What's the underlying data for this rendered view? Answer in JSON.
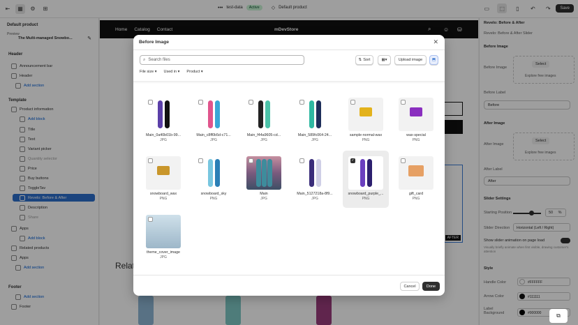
{
  "topbar": {
    "theme_name": "test-data",
    "theme_status": "Active",
    "template": "Default product",
    "save": "Save"
  },
  "left_panel": {
    "title": "Default product",
    "preview_label": "Preview",
    "preview_value": "The Multi-managed Snowbo...",
    "header_group": "Header",
    "header_items": [
      "Announcement bar",
      "Header"
    ],
    "add_section": "Add section",
    "template_group": "Template",
    "template_items": [
      "Product information",
      "Add block",
      "Title",
      "Text",
      "Variant picker",
      "Quantity selector",
      "Price",
      "Buy buttons",
      "ToggleTav",
      "Revelo: Before & After",
      "Description",
      "Share",
      "Apps",
      "Add block",
      "Related products",
      "Apps",
      "Add section"
    ],
    "footer_group": "Footer",
    "footer_items": [
      "Add section",
      "Footer"
    ]
  },
  "store": {
    "nav": [
      "Home",
      "Catalog",
      "Contact"
    ],
    "brand": "mDevStore",
    "related": "Relat",
    "badge": "AFTER"
  },
  "right_panel": {
    "title": "Revelo: Before & After",
    "subtitle": "Revelo: Before & After Slider",
    "before_image": "Before Image",
    "before_image_label": "Before Image",
    "select": "Select",
    "explore": "Explore free images",
    "before_label": "Before Label",
    "before_value": "Before",
    "after_image": "After Image",
    "after_image_label": "After Image",
    "select2": "Select",
    "explore2": "Explore free images",
    "after_label": "After Label",
    "after_value": "After",
    "slider_settings": "Slider Settings",
    "starting_position": "Starting Position",
    "starting_value": "50",
    "starting_unit": "%",
    "slider_direction": "Slider Direction",
    "direction_value": "Horizontal (Left / Right)",
    "show_anim": "Show slider animation on page load",
    "show_anim_desc": "Visually briefly animate when first visible, drawing customer's attention",
    "style": "Style",
    "handle_color": "Handle Color",
    "handle_value": "#FFFFFF",
    "arrow_color": "Arrow Color",
    "arrow_value": "#111111",
    "label_bg": "Label Background",
    "label_bg_value": "#000000"
  },
  "modal": {
    "title": "Before Image",
    "search_placeholder": "Search files",
    "sort": "Sort",
    "upload": "Upload image",
    "filters": [
      "File size",
      "Used in",
      "Product"
    ],
    "files": [
      {
        "name": "Main_0a40b01b-99...",
        "type": "JPG",
        "color": "#5b3fa8",
        "color2": "#111111"
      },
      {
        "name": "Main_c8ff0b5d-c71...",
        "type": "JPG",
        "color": "#e0558c",
        "color2": "#3aa7d6"
      },
      {
        "name": "Main_f44a9605-cd...",
        "type": "JPG",
        "color": "#222222",
        "color2": "#4cc2a8"
      },
      {
        "name": "Main_589fc064-24...",
        "type": "JPG",
        "color": "#2fb8a2",
        "color2": "#1d2e5a"
      },
      {
        "name": "sample-normal-wax",
        "type": "PNG",
        "color": "#e3b21c",
        "color2": ""
      },
      {
        "name": "wax-special",
        "type": "PNG",
        "color": "#8a2fbf",
        "color2": ""
      },
      {
        "name": "snowboard_wax",
        "type": "PNG",
        "color": "#c9962b",
        "color2": ""
      },
      {
        "name": "snowboard_sky",
        "type": "PNG",
        "color": "#78c6df",
        "color2": "#2b7fb6"
      },
      {
        "name": "Main",
        "type": "JPG",
        "color": "#7a5a7e",
        "color2": "#3e8c9c"
      },
      {
        "name": "Main_5127218a-8f9...",
        "type": "JPG",
        "color": "#3a2d7a",
        "color2": "#cfcfe6"
      },
      {
        "name": "snowboard_purple_...",
        "type": "PNG",
        "color": "#6a3fbf",
        "color2": "#2c1f6e"
      },
      {
        "name": "gift_card",
        "type": "PNG",
        "color": "#e6a064",
        "color2": ""
      },
      {
        "name": "theme_cover_image",
        "type": "JPG",
        "color": "#9db7c9",
        "color2": ""
      }
    ],
    "selected_index": 10,
    "cancel": "Cancel",
    "done": "Done"
  }
}
